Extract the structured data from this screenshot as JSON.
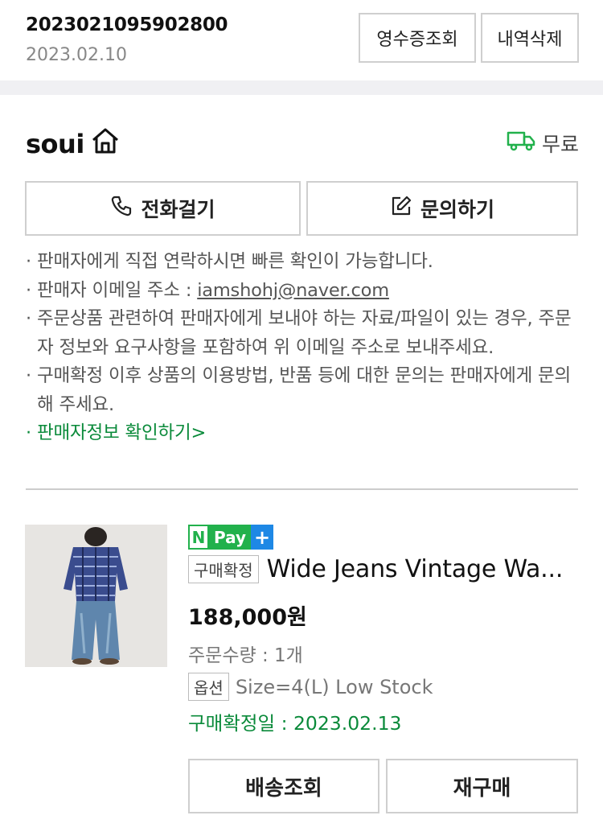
{
  "order": {
    "number": "2023021095902800",
    "date": "2023.02.10",
    "receipt_button": "영수증조회",
    "delete_button": "내역삭제"
  },
  "seller": {
    "name": "soui",
    "shipping": "무료",
    "call_button": "전화걸기",
    "inquiry_button": "문의하기"
  },
  "notices": {
    "items": [
      "판매자에게 직접 연락하시면 빠른 확인이 가능합니다.",
      "주문상품 관련하여 판매자에게 보내야 하는 자료/파일이 있는 경우, 주문자 정보와 요구사항을 포함하여 위 이메일 주소로 보내주세요.",
      "구매확정 이후 상품의 이용방법, 반품 등에 대한 문의는 판매자에게 문의해 주세요."
    ],
    "email_label": "판매자 이메일 주소 : ",
    "email": "iamshohj@naver.com",
    "seller_info_link": "판매자정보 확인하기>"
  },
  "product": {
    "badge": {
      "n": "N",
      "pay": "Pay",
      "plus": "+"
    },
    "status_tag": "구매확정",
    "title": "Wide Jeans Vintage Wa...",
    "price": "188,000원",
    "quantity": "주문수량 : 1개",
    "option_tag": "옵션",
    "option_value": "Size=4(L) Low Stock",
    "confirm_date": "구매확정일 : 2023.02.13",
    "track_button": "배송조회",
    "rebuy_button": "재구매"
  },
  "colors": {
    "accent_green": "#0a8a3a",
    "npay_green": "#22b14c",
    "npay_blue": "#1e88e5",
    "border": "#cfcfcf",
    "band": "#f0f0f3"
  }
}
